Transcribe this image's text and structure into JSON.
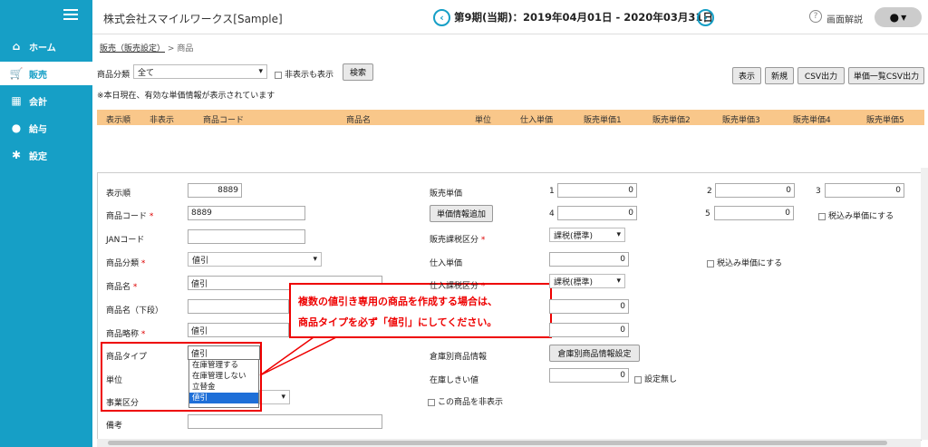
{
  "sidebar": {
    "items": [
      {
        "label": "ホーム",
        "icon": "home-icon"
      },
      {
        "label": "販売",
        "icon": "cart-icon"
      },
      {
        "label": "会計",
        "icon": "calculator-icon"
      },
      {
        "label": "給与",
        "icon": "money-bag-icon"
      },
      {
        "label": "設定",
        "icon": "gear-icon"
      }
    ]
  },
  "header": {
    "company": "株式会社スマイルワークス[Sample]",
    "period": "第9期(当期)：2019年04月01日 - 2020年03月31日",
    "help": "画面解説"
  },
  "breadcrumb": {
    "link": "販売（販売設定）",
    "sep": ">",
    "current": "商品"
  },
  "filter": {
    "category_label": "商品分類",
    "category_value": "全て",
    "hidden_label": "非表示も表示",
    "search": "検索",
    "note": "※本日現在、有効な単価情報が表示されています"
  },
  "toolbar": {
    "show": "表示",
    "new": "新規",
    "csv": "CSV出力",
    "price_csv": "単価一覧CSV出力"
  },
  "table": {
    "headers": [
      "表示順",
      "非表示",
      "商品コード",
      "商品名",
      "単位",
      "仕入単価",
      "販売単価1",
      "販売単価2",
      "販売単価3",
      "販売単価4",
      "販売単価5"
    ]
  },
  "form": {
    "order_label": "表示順",
    "order_value": "8889",
    "code_label": "商品コード",
    "code_value": "8889",
    "jan_label": "JANコード",
    "category_label": "商品分類",
    "category_value": "値引",
    "name_label": "商品名",
    "name_value": "値引",
    "name2_label": "商品名（下段）",
    "short_label": "商品略称",
    "short_value": "値引",
    "type_label": "商品タイプ",
    "type_value": "値引",
    "type_options": [
      "在庫管理する",
      "在庫管理しない",
      "立替金",
      "値引"
    ],
    "unit_label": "単位",
    "division_label": "事業区分",
    "remarks_label": "備考",
    "sale_price_label": "販売単価",
    "p1": "1",
    "p2": "2",
    "p3": "3",
    "p4": "4",
    "p5": "5",
    "p1_value": "0",
    "p2_value": "0",
    "p3_value": "0",
    "p4_value": "0",
    "p5_value": "0",
    "add_price_btn": "単価情報追加",
    "tax_incl_label": "税込み単価にする",
    "sale_tax_label": "販売課税区分",
    "sale_tax_value": "課税(標準)",
    "purchase_price_label": "仕入単価",
    "purchase_price_value": "0",
    "purchase_tax_incl_label": "税込み単価にする",
    "purchase_tax_label": "仕入課税区分",
    "purchase_tax_value": "課税(標準)",
    "extra_value_1": "0",
    "extra_value_2": "0",
    "warehouse_label": "倉庫別商品情報",
    "warehouse_btn": "倉庫別商品情報設定",
    "threshold_label": "在庫しきい値",
    "threshold_value": "0",
    "no_setting_label": "設定無し",
    "hide_label": "この商品を非表示"
  },
  "callout": {
    "line1": "複数の値引き専用の商品を作成する場合は、",
    "line2": "商品タイプを必ず「値引」にしてください。"
  }
}
